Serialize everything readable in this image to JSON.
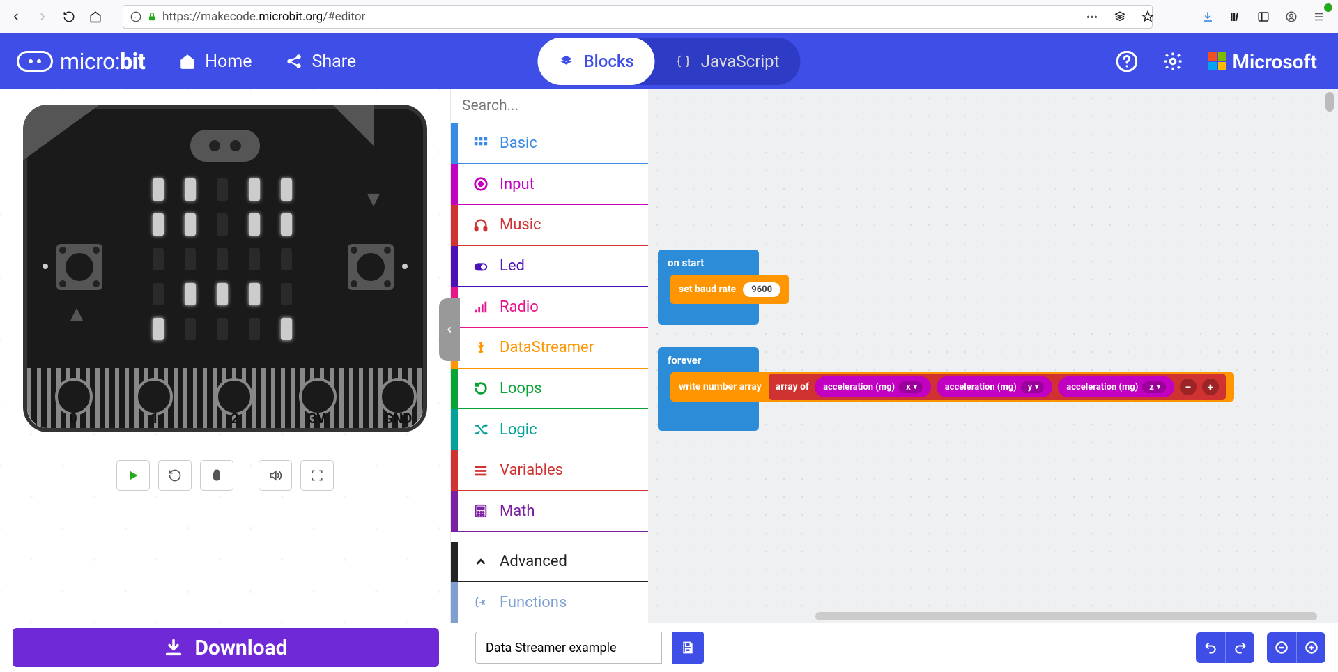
{
  "browser": {
    "url_prefix": "https://makecode.",
    "url_host": "microbit.org",
    "url_suffix": "/#editor"
  },
  "header": {
    "logo_a": "micro:",
    "logo_b": "bit",
    "home": "Home",
    "share": "Share",
    "blocks": "Blocks",
    "javascript": "JavaScript",
    "microsoft": "Microsoft"
  },
  "toolbox": {
    "search_placeholder": "Search...",
    "basic": "Basic",
    "input": "Input",
    "music": "Music",
    "led": "Led",
    "radio": "Radio",
    "datastreamer": "DataStreamer",
    "loops": "Loops",
    "logic": "Logic",
    "variables": "Variables",
    "math": "Math",
    "advanced": "Advanced",
    "functions": "Functions"
  },
  "sim": {
    "pin0": "0",
    "pin1": "1",
    "pin2": "2",
    "pin3v": "3V",
    "pingnd": "GND"
  },
  "blocks": {
    "on_start": "on start",
    "set_baud": "set baud rate",
    "baud_val": "9600",
    "forever": "forever",
    "write_arr": "write number array",
    "array_of": "array of",
    "accel": "acceleration (mg)",
    "x": "x",
    "y": "y",
    "z": "z"
  },
  "bottom": {
    "download": "Download",
    "project_name": "Data Streamer example"
  }
}
